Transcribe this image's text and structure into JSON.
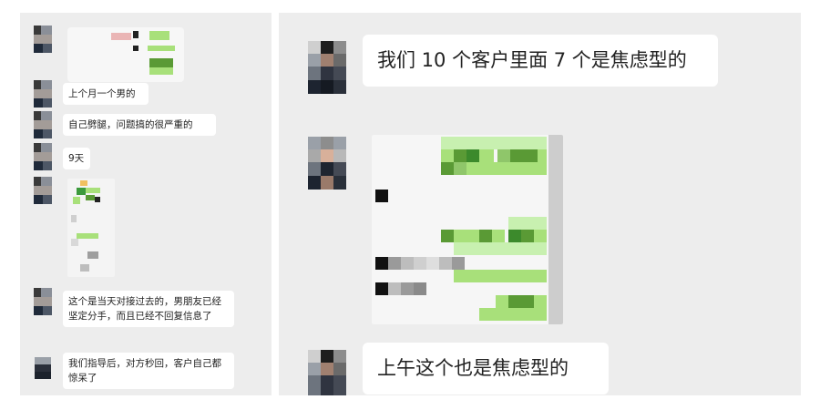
{
  "left_chat": {
    "messages": [
      {
        "type": "image",
        "text": ""
      },
      {
        "type": "text",
        "text": "上个月一个男的"
      },
      {
        "type": "text",
        "text": "自己劈腿，问题搞的很严重的"
      },
      {
        "type": "text",
        "text": "9天"
      },
      {
        "type": "image",
        "text": ""
      },
      {
        "type": "text",
        "text": "这个是当天对接过去的，男朋友已经坚定分手，而且已经不回复信息了"
      },
      {
        "type": "text",
        "text": "我们指导后，对方秒回，客户自己都惊呆了"
      }
    ]
  },
  "right_chat": {
    "messages": [
      {
        "type": "text",
        "text": "我们 10 个客户里面 7 个是焦虑型的"
      },
      {
        "type": "image",
        "text": ""
      },
      {
        "type": "text",
        "text": "上午这个也是焦虑型的"
      }
    ]
  },
  "colors": {
    "panel_bg": "#ededed",
    "bubble_bg": "#ffffff",
    "text": "#222222",
    "pixel_green": "#a8e07a",
    "pixel_dark_green": "#5a9a35"
  },
  "icons": {
    "avatar": "pixelated-avatar-icon",
    "image_message": "pixelated-screenshot-image"
  }
}
